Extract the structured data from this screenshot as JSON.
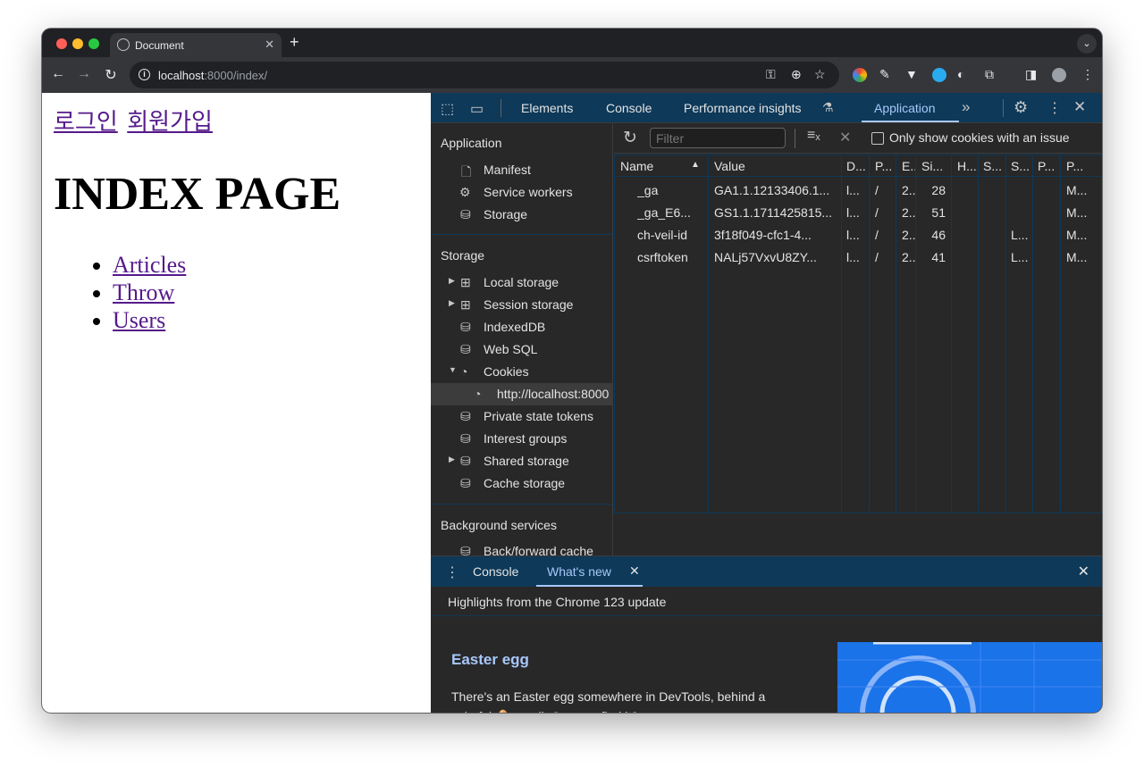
{
  "browser": {
    "tab_title": "Document",
    "url_host": "localhost",
    "url_rest": ":8000/index/"
  },
  "page": {
    "auth_links": [
      "로그인",
      "회원가입"
    ],
    "heading": "INDEX PAGE",
    "links": [
      "Articles",
      "Throw",
      "Users"
    ]
  },
  "devtools": {
    "tabs": [
      "Elements",
      "Console",
      "Performance insights",
      "Application"
    ],
    "active_tab": "Application",
    "sidebar": {
      "application_header": "Application",
      "application_items": [
        "Manifest",
        "Service workers",
        "Storage"
      ],
      "storage_header": "Storage",
      "storage_items": [
        "Local storage",
        "Session storage",
        "IndexedDB",
        "Web SQL",
        "Cookies",
        "Private state tokens",
        "Interest groups",
        "Shared storage",
        "Cache storage"
      ],
      "cookie_origin": "http://localhost:8000",
      "background_header": "Background services",
      "background_items": [
        "Back/forward cache"
      ]
    },
    "cookies": {
      "filter_placeholder": "Filter",
      "only_issue_label": "Only show cookies with an issue",
      "columns": [
        "Name",
        "Value",
        "D...",
        "P...",
        "E...",
        "Si...",
        "H...",
        "S...",
        "S...",
        "P...",
        "P..."
      ],
      "rows": [
        {
          "name": "_ga",
          "value": "GA1.1.12133406.1...",
          "domain": "l...",
          "path": "/",
          "expires": "2...",
          "size": "28",
          "samesite": "",
          "priority": "M..."
        },
        {
          "name": "_ga_E6...",
          "value": "GS1.1.1711425815...",
          "domain": "l...",
          "path": "/",
          "expires": "2...",
          "size": "51",
          "samesite": "",
          "priority": "M..."
        },
        {
          "name": "ch-veil-id",
          "value": "3f18f049-cfc1-4...",
          "domain": "l...",
          "path": "/",
          "expires": "2...",
          "size": "46",
          "samesite": "L...",
          "priority": "M..."
        },
        {
          "name": "csrftoken",
          "value": "NALj57VxvU8ZY...",
          "domain": "l...",
          "path": "/",
          "expires": "2...",
          "size": "41",
          "samesite": "L...",
          "priority": "M..."
        }
      ]
    },
    "drawer": {
      "tabs": [
        "Console",
        "What's new"
      ],
      "active_tab": "What's new",
      "highlights": "Highlights from the Chrome 123 update",
      "article_title": "Easter egg",
      "article_text": "There's an Easter egg somewhere in DevTools, behind a colorful 🥚 emoji. Can you find it?"
    }
  },
  "colors": {
    "devtools_bg": "#282828",
    "devtools_header": "#0e3959",
    "accent": "#a8c7fa",
    "link_visited": "#551a8b"
  }
}
